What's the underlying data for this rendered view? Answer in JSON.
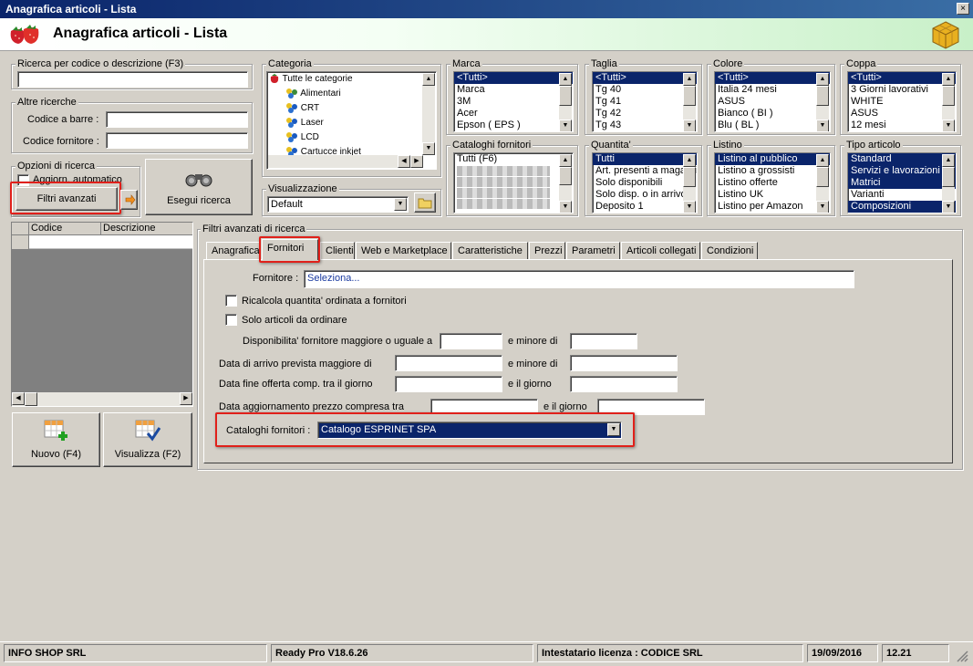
{
  "window": {
    "title": "Anagrafica articoli  - Lista",
    "close_label": "×",
    "header_title": "Anagrafica articoli  - Lista"
  },
  "search": {
    "code_desc_label": "Ricerca per codice o descrizione (F3)",
    "code_desc_value": "",
    "other_label": "Altre ricerche",
    "barcode_label": "Codice a barre :",
    "barcode_value": "",
    "supplier_code_label": "Codice fornitore :",
    "supplier_code_value": "",
    "options_label": "Opzioni di ricerca",
    "auto_update_label": "Aggiorn. automatico",
    "advanced_filters_button": "Filtri avanzati",
    "run_search_button": "Esegui ricerca"
  },
  "category": {
    "label": "Categoria",
    "root": "Tutte le categorie",
    "items": [
      "Alimentari",
      "CRT",
      "Laser",
      "LCD",
      "Cartucce inkjet"
    ]
  },
  "view": {
    "label": "Visualizzazione",
    "value": "Default"
  },
  "filters": {
    "marca": {
      "label": "Marca",
      "items": [
        "<Tutti>",
        "Marca",
        "3M",
        "Acer",
        "Epson ( EPS )"
      ],
      "selected": [
        0
      ]
    },
    "taglia": {
      "label": "Taglia",
      "items": [
        "<Tutti>",
        "Tg 40",
        "Tg 41",
        "Tg 42",
        "Tg 43"
      ],
      "selected": [
        0
      ]
    },
    "colore": {
      "label": "Colore",
      "items": [
        "<Tutti>",
        "Italia 24 mesi",
        "ASUS",
        "Bianco ( BI )",
        "Blu ( BL )"
      ],
      "selected": [
        0
      ]
    },
    "coppa": {
      "label": "Coppa",
      "items": [
        "<Tutti>",
        "3 Giorni lavorativi",
        "WHITE",
        "ASUS",
        "12 mesi"
      ],
      "selected": [
        0
      ]
    },
    "cataloghi": {
      "label": "Cataloghi fornitori",
      "items": [
        "Tutti (F6)"
      ],
      "selected": []
    },
    "quantita": {
      "label": "Quantita'",
      "items": [
        "Tutti",
        "Art. presenti a magazzino",
        "Solo disponibili",
        "Solo disp. o in arrivo",
        "Deposito 1"
      ],
      "selected": [
        0
      ]
    },
    "listino": {
      "label": "Listino",
      "items": [
        "Listino al pubblico",
        "Listino a grossisti",
        "Listino offerte",
        "Listino UK",
        "Listino per Amazon"
      ],
      "selected": [
        0
      ]
    },
    "tipo": {
      "label": "Tipo articolo",
      "items": [
        "Standard",
        "Servizi e lavorazioni",
        "Matrici",
        "Varianti",
        "Composizioni"
      ],
      "selected": [
        0,
        1,
        2,
        4
      ]
    }
  },
  "grid": {
    "col_code": "Codice",
    "col_desc": "Descrizione"
  },
  "actions": {
    "new_button": "Nuovo (F4)",
    "view_button": "Visualizza (F2)"
  },
  "advanced": {
    "group_label": "Filtri avanzati di ricerca",
    "tabs": [
      "Anagrafica",
      "Fornitori",
      "Clienti",
      "Web e Marketplace",
      "Caratteristiche",
      "Prezzi",
      "Parametri",
      "Articoli collegati",
      "Condizioni"
    ],
    "active_tab": 1,
    "supplier_label": "Fornitore :",
    "supplier_value": "Seleziona...",
    "recalc_label": "Ricalcola quantita' ordinata a fornitori",
    "only_to_order_label": "Solo articoli da ordinare",
    "availability_label": "Disponibilita' fornitore maggiore o uguale a",
    "less_than_label": "e minore di",
    "arrival_label": "Data di arrivo prevista maggiore di",
    "offer_end_label": "Data fine offerta comp. tra il giorno",
    "and_day_label": "e il giorno",
    "price_update_label": "Data aggiornamento prezzo compresa tra",
    "catalogs_label": "Cataloghi fornitori :",
    "catalogs_value": "Catalogo ESPRINET SPA"
  },
  "status": {
    "company": "INFO SHOP SRL",
    "version": "Ready Pro V18.6.26",
    "license": "Intestatario licenza : CODICE SRL",
    "date": "19/09/2016",
    "time": "12.21"
  },
  "colors": {
    "selection": "#0a246a",
    "highlight": "#e0201a",
    "face": "#d4d0c8"
  }
}
